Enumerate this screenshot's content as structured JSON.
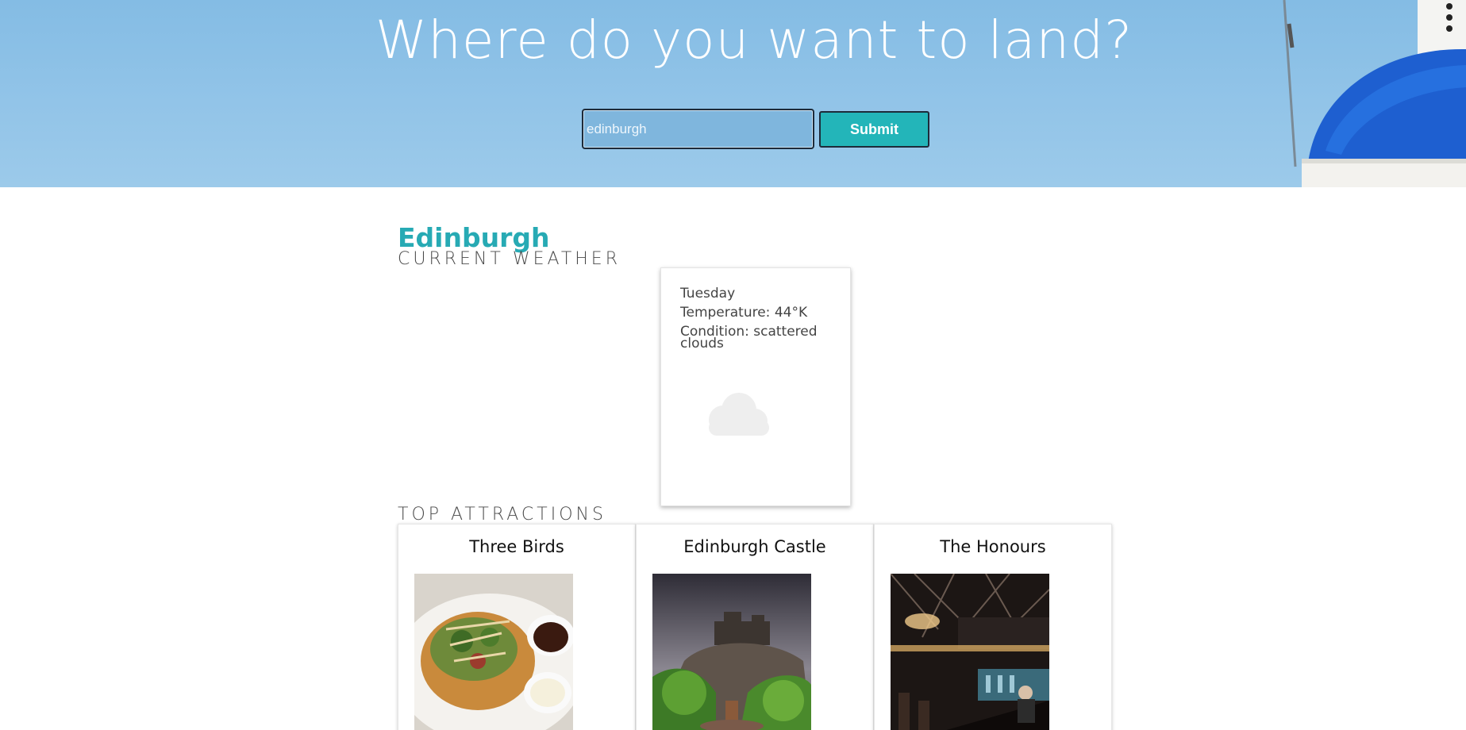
{
  "hero": {
    "title": "Where do you want to land?",
    "search_value": "edinburgh",
    "submit_label": "Submit"
  },
  "city": {
    "name": "Edinburgh"
  },
  "weather": {
    "heading": "CURRENT WEATHER",
    "day": "Tuesday",
    "temperature": "Temperature: 44°K",
    "condition": "Condition: scattered clouds",
    "icon": "cloud-icon"
  },
  "attractions": {
    "heading": "TOP ATTRACTIONS",
    "items": [
      {
        "name": "Three Birds"
      },
      {
        "name": "Edinburgh Castle"
      },
      {
        "name": "The Honours"
      }
    ]
  },
  "colors": {
    "accent": "#27aab4",
    "button": "#23b5b9",
    "hero_sky": "#8fc2e6"
  }
}
